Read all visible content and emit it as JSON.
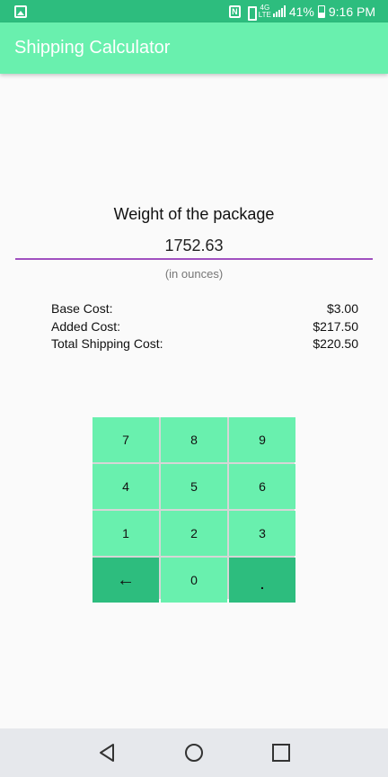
{
  "status_bar": {
    "battery": "41%",
    "time": "9:16 PM",
    "lte": "4G LTE"
  },
  "app_bar": {
    "title": "Shipping Calculator"
  },
  "form": {
    "weight_label": "Weight of the package",
    "weight_value": "1752.63",
    "unit_hint": "(in ounces)"
  },
  "costs": [
    {
      "label": "Base Cost:",
      "value": "$3.00"
    },
    {
      "label": "Added Cost:",
      "value": "$217.50"
    },
    {
      "label": "Total Shipping Cost:",
      "value": "$220.50"
    }
  ],
  "keypad": {
    "keys": [
      "7",
      "8",
      "9",
      "4",
      "5",
      "6",
      "1",
      "2",
      "3",
      "←",
      "0",
      "."
    ]
  },
  "colors": {
    "accent": "#69f0ae",
    "primary_dark": "#2dbd7e",
    "input_underline": "#a050c0",
    "nav_bar": "#e6e8ec"
  },
  "icons": {
    "status_left": "gallery-icon",
    "backspace": "backspace-arrow-icon",
    "nav": [
      "back-icon",
      "home-icon",
      "recents-icon"
    ]
  }
}
